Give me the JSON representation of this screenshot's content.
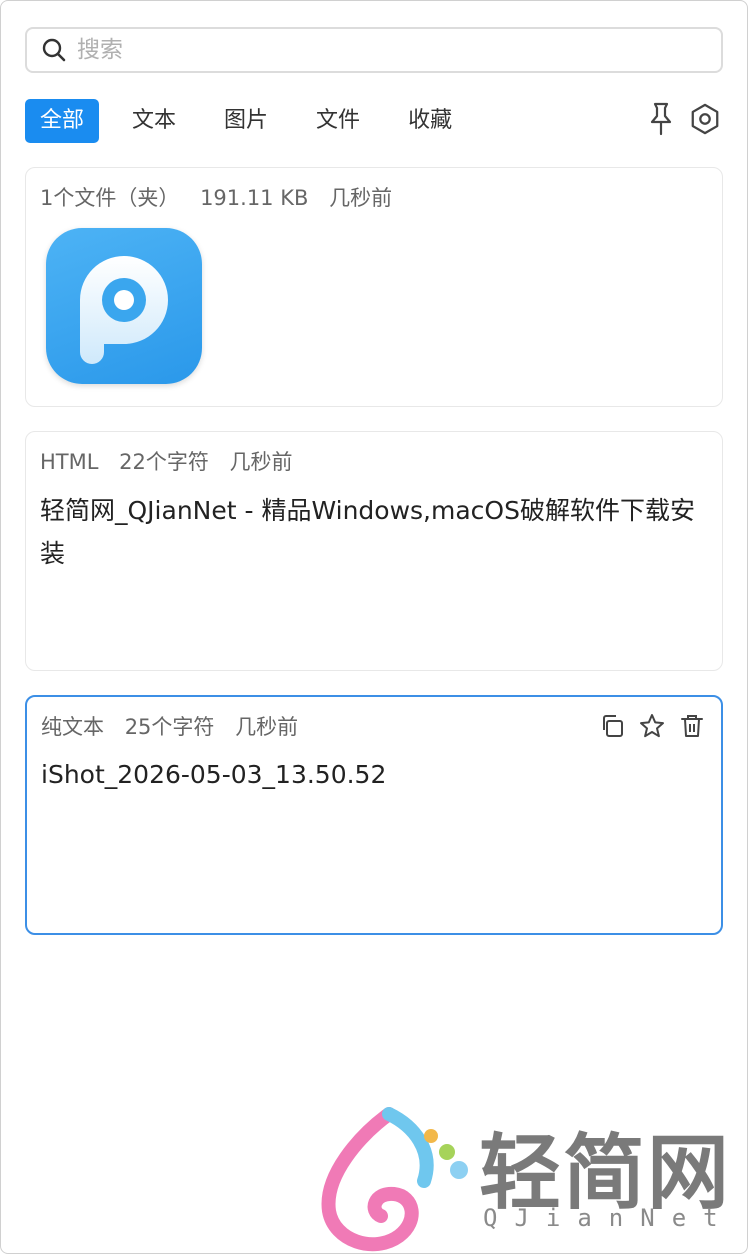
{
  "search": {
    "placeholder": "搜索",
    "value": ""
  },
  "tabs": [
    {
      "label": "全部",
      "active": true
    },
    {
      "label": "文本",
      "active": false
    },
    {
      "label": "图片",
      "active": false
    },
    {
      "label": "文件",
      "active": false
    },
    {
      "label": "收藏",
      "active": false
    }
  ],
  "toolbar": {
    "pin_icon": "pin-icon",
    "settings_icon": "settings-icon"
  },
  "items": [
    {
      "type": "1个文件（夹）",
      "size": "191.11 KB",
      "time": "几秒前",
      "icon": "pdf-app-icon"
    },
    {
      "type": "HTML",
      "size": "22个字符",
      "time": "几秒前",
      "content": "轻简网_QJianNet - 精品Windows,macOS破解软件下载安装"
    },
    {
      "type": "纯文本",
      "size": "25个字符",
      "time": "几秒前",
      "content": "iShot_2026-05-03_13.50.52",
      "selected": true
    }
  ],
  "watermark": {
    "title": "轻简网",
    "subtitle": "QJianNet"
  },
  "colors": {
    "accent": "#1a8cf0",
    "selected_border": "#3c8fe6"
  }
}
